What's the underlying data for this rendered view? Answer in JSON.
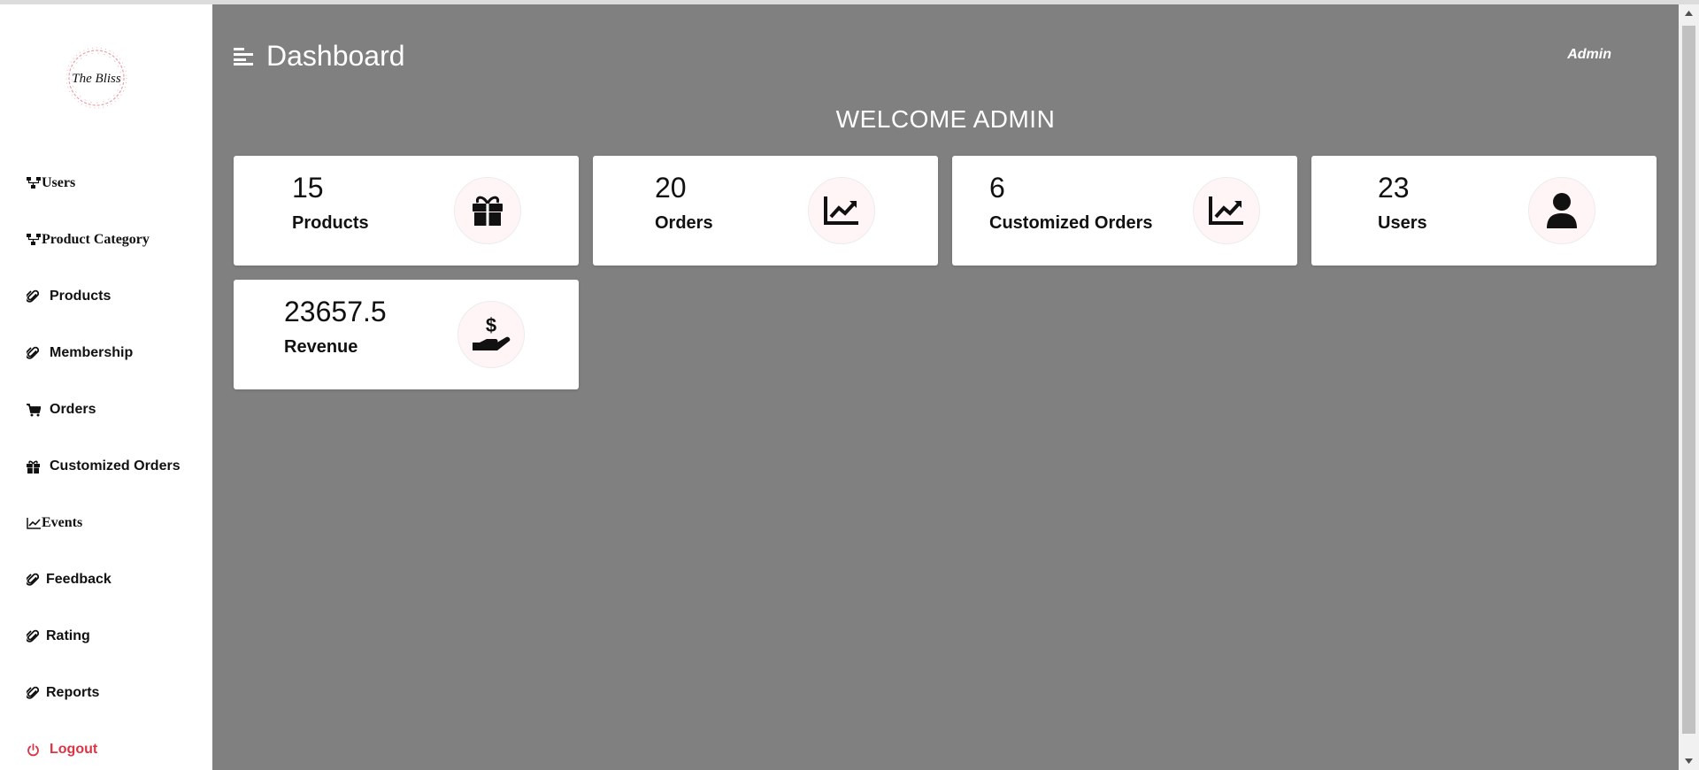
{
  "sidebar": {
    "logo_text": "The Bliss",
    "items": [
      {
        "label": "Users",
        "icon": "sitemap-icon"
      },
      {
        "label": "Product Category",
        "icon": "sitemap-icon"
      },
      {
        "label": "Products",
        "icon": "paperclip-icon"
      },
      {
        "label": "Membership",
        "icon": "paperclip-icon"
      },
      {
        "label": "Orders",
        "icon": "cart-icon"
      },
      {
        "label": "Customized Orders",
        "icon": "gift-icon"
      },
      {
        "label": "Events",
        "icon": "chart-line-icon"
      },
      {
        "label": "Feedback",
        "icon": "paperclip-icon"
      },
      {
        "label": "Rating",
        "icon": "paperclip-icon"
      },
      {
        "label": "Reports",
        "icon": "paperclip-icon"
      },
      {
        "label": "Logout",
        "icon": "power-icon"
      }
    ]
  },
  "header": {
    "title": "Dashboard",
    "user": "Admin"
  },
  "welcome": "WELCOME ADMIN",
  "cards": [
    {
      "value": "15",
      "label": "Products",
      "icon": "gift-icon"
    },
    {
      "value": "20",
      "label": "Orders",
      "icon": "chart-line-icon"
    },
    {
      "value": "6",
      "label": "Customized Orders",
      "icon": "chart-line-icon"
    },
    {
      "value": "23",
      "label": "Users",
      "icon": "user-icon"
    },
    {
      "value": "23657.5",
      "label": "Revenue",
      "icon": "hand-dollar-icon"
    }
  ],
  "colors": {
    "main_bg": "#808080",
    "logout": "#dc3545",
    "icon_circle": "#fff5f6",
    "logo_wreath": "#e8a0a8"
  }
}
